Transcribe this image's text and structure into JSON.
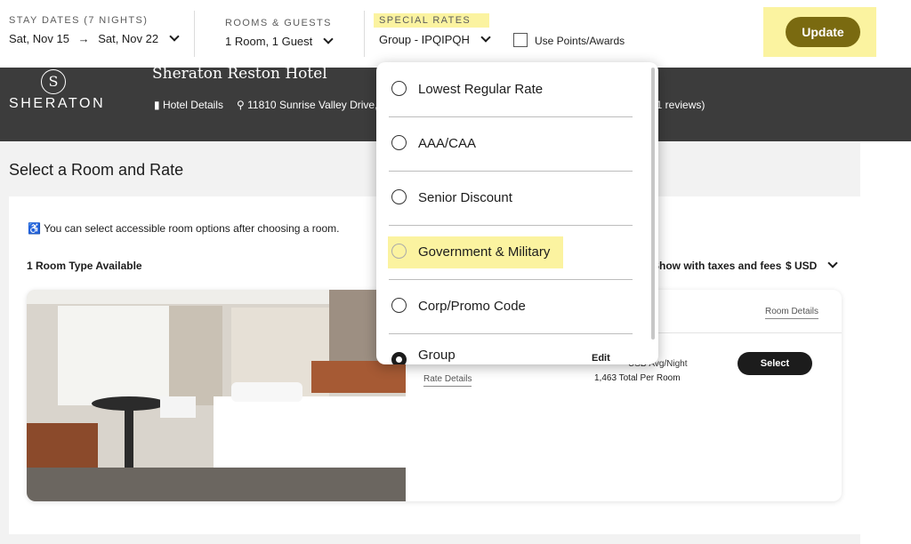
{
  "search_bar": {
    "stay_dates_label": "STAY DATES (7 NIGHTS)",
    "check_in": "Sat, Nov 15",
    "arrow": "→",
    "check_out": "Sat, Nov 22",
    "rooms_label": "ROOMS & GUESTS",
    "rooms_value": "1 Room, 1 Guest",
    "special_rates_label": "SPECIAL RATES",
    "special_rates_value": "Group - IPQIPQH",
    "use_points_label": "Use Points/Awards",
    "update_label": "Update"
  },
  "hero": {
    "brand": "SHERATON",
    "brand_mark": "S",
    "hotel_name": "Sheraton Reston Hotel",
    "hotel_details": "Hotel Details",
    "address": "11810 Sunrise Valley Drive,",
    "reviews_fragment": "51 reviews)"
  },
  "main": {
    "heading": "Select a Room and Rate",
    "accessible_note": "You can select accessible room options after choosing a room.",
    "room_types": "1 Room Type Available",
    "show_taxes": "Show with taxes and fees",
    "currency": "$ USD"
  },
  "room_card": {
    "room_details": "Room Details",
    "rate_details": "Rate Details",
    "price_fragment": "USD Avg/Night",
    "total": "1,463 Total Per Room",
    "edit": "Edit",
    "select_label": "Select"
  },
  "rates_dropdown": {
    "options": [
      {
        "label": "Lowest Regular Rate",
        "selected": false
      },
      {
        "label": "AAA/CAA",
        "selected": false
      },
      {
        "label": "Senior Discount",
        "selected": false
      },
      {
        "label": "Government & Military",
        "selected": false,
        "highlighted": true
      },
      {
        "label": "Corp/Promo Code",
        "selected": false
      },
      {
        "label": "Group",
        "selected": true
      }
    ]
  },
  "colors": {
    "highlight": "#fbf3a0",
    "update_button": "#7a6a10",
    "hero_bg": "#3c3c3c"
  }
}
